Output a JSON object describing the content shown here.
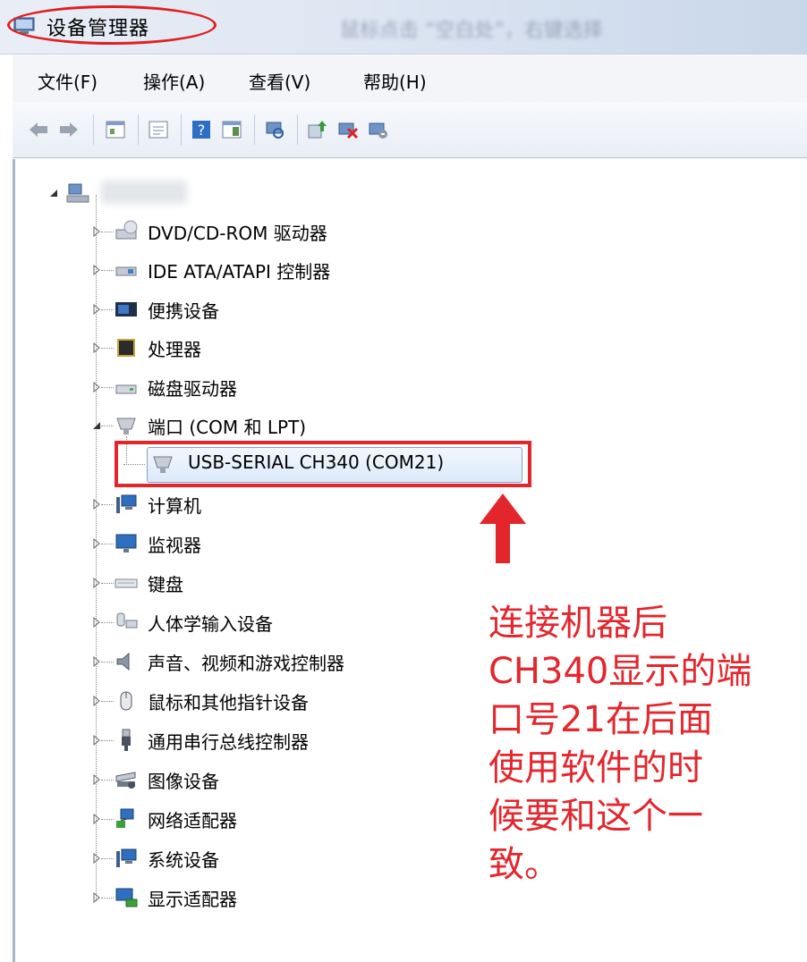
{
  "window": {
    "title": "设备管理器",
    "hint": "鼠标点击 “空白处”，右键选择"
  },
  "menu": [
    "文件(F)",
    "操作(A)",
    "查看(V)",
    "帮助(H)"
  ],
  "toolbar": {
    "buttons": [
      "back-icon",
      "forward-icon",
      "properties-icon",
      "console-tree-icon",
      "help-icon",
      "action-pane-icon",
      "scan-hardware-icon",
      "update-driver-icon",
      "uninstall-icon",
      "disable-icon"
    ]
  },
  "tree": {
    "root_label": "",
    "items": [
      {
        "label": "DVD/CD-ROM 驱动器",
        "icon": "dvd-drive-icon"
      },
      {
        "label": "IDE ATA/ATAPI 控制器",
        "icon": "ide-controller-icon"
      },
      {
        "label": "便携设备",
        "icon": "portable-device-icon"
      },
      {
        "label": "处理器",
        "icon": "processor-icon"
      },
      {
        "label": "磁盘驱动器",
        "icon": "disk-drive-icon"
      },
      {
        "label": "端口 (COM 和 LPT)",
        "icon": "port-icon",
        "expanded": true
      },
      {
        "label": "USB-SERIAL CH340 (COM21)",
        "icon": "serial-port-icon",
        "child": true,
        "selected": true
      },
      {
        "label": "计算机",
        "icon": "computer-icon"
      },
      {
        "label": "监视器",
        "icon": "monitor-icon"
      },
      {
        "label": "键盘",
        "icon": "keyboard-icon"
      },
      {
        "label": "人体学输入设备",
        "icon": "hid-icon"
      },
      {
        "label": "声音、视频和游戏控制器",
        "icon": "sound-icon"
      },
      {
        "label": "鼠标和其他指针设备",
        "icon": "mouse-icon"
      },
      {
        "label": "通用串行总线控制器",
        "icon": "usb-icon"
      },
      {
        "label": "图像设备",
        "icon": "imaging-device-icon"
      },
      {
        "label": "网络适配器",
        "icon": "network-adapter-icon"
      },
      {
        "label": "系统设备",
        "icon": "system-device-icon"
      },
      {
        "label": "显示适配器",
        "icon": "display-adapter-icon"
      }
    ]
  },
  "annotation": {
    "lines": [
      "连接机器后",
      "CH340显示的端",
      "口号21在后面",
      "使用软件的时",
      "候要和这个一",
      "致。"
    ],
    "color": "#e4262d"
  }
}
